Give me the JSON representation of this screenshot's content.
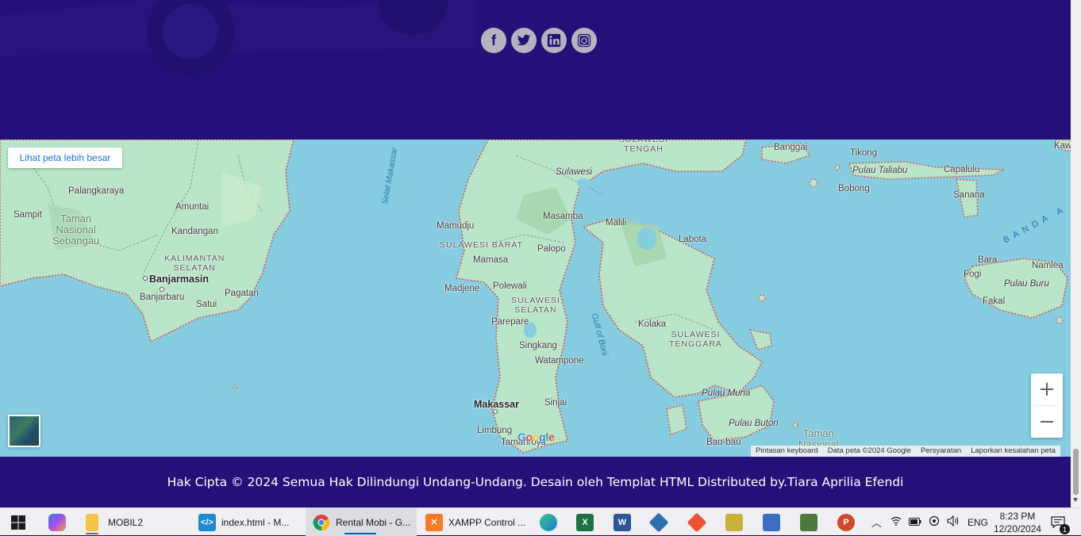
{
  "social": {
    "facebook": "f",
    "twitter": "t",
    "linkedin": "in",
    "instagram": "ig"
  },
  "map": {
    "larger_map_label": "Lihat peta lebih besar",
    "zoom_in": "+",
    "zoom_out": "−",
    "attribution": [
      "Pintasan keyboard",
      "Data peta ©2024 Google",
      "Persyaratan",
      "Laporkan kesalahan peta"
    ],
    "google_logo": [
      "G",
      "o",
      "o",
      "g",
      "l",
      "e"
    ],
    "logo_colors": [
      "#4285f4",
      "#ea4335",
      "#fbbc05",
      "#4285f4",
      "#34a853",
      "#ea4335"
    ],
    "labels": {
      "palangkaraya": "Palangkaraya",
      "sampit": "Sampit",
      "taman_nasional_sebangau": "Taman\nNasional\nSebangau",
      "amuntai": "Amuntai",
      "kandangan": "Kandangan",
      "kalimantan_selatan": "KALIMANTAN\nSELATAN",
      "banjarmasin": "Banjarmasin",
      "banjarbaru": "Banjarbaru",
      "satui": "Satui",
      "pagatan": "Pagatan",
      "selat_makassar": "Selat Makassar",
      "sulawesi_tengah": "SULAWESI\nTENGAH",
      "sulawesi": "Sulawesi",
      "mamudju": "Mamudju",
      "masamba": "Masamba",
      "malili": "Malili",
      "sulawesi_barat": "SULAWESI BARAT",
      "mamasa": "Mamasa",
      "palopo": "Palopo",
      "labota": "Labota",
      "majene": "Madjene",
      "polewali": "Polewali",
      "sulawesi_selatan": "SULAWESI\nSELATAN",
      "parepare": "Parepare",
      "gulf_of_boni": "Gulf of Boni",
      "kolaka": "Kolaka",
      "sulawesi_tenggara": "SULAWESI\nTENGGARA",
      "singkang": "Singkang",
      "watampone": "Watampone",
      "makassar": "Makassar",
      "sinjai": "Sinjai",
      "pulau_muna": "Pulau Muna",
      "pulau_buton": "Pulau Buton",
      "limbung": "Limbung",
      "tamanroya": "Tamanroya",
      "bau_bau": "Bau-bau",
      "taman_nasional": "Taman\nNasional",
      "banggai": "Banggai",
      "tikong": "Tikong",
      "pulau_taliabu": "Pulau Taliabu",
      "capalulu": "Capalulu",
      "bobong": "Bobong",
      "sanana": "Sanana",
      "banda_sea": "BANDA A",
      "bara": "Bara",
      "namlea": "Namlea",
      "fogi": "Fogi",
      "pulau_buru": "Pulau Buru",
      "fakal": "Fakal",
      "kaw": "Kaw"
    }
  },
  "footer": {
    "copyright": "Hak Cipta © 2024 Semua Hak Dilindungi Undang-Undang. Desain oleh Templat HTML Distributed by.Tiara Aprilia Efendi"
  },
  "taskbar": {
    "apps": [
      {
        "name": "start",
        "label": ""
      },
      {
        "name": "copilot",
        "label": ""
      },
      {
        "name": "explorer",
        "label": "MOBIL2"
      },
      {
        "name": "vscode",
        "label": "index.html - M..."
      },
      {
        "name": "chrome",
        "label": "Rental Mobi - G..."
      },
      {
        "name": "xampp",
        "label": "XAMPP Control ..."
      }
    ],
    "language": "ENG",
    "time": "8:23 PM",
    "date": "12/20/2024",
    "notification_count": "1"
  },
  "colors": {
    "footer_bg": "#25107a",
    "water": "#86cde2",
    "land": "#bfe6cc",
    "border_red": "#d9534f"
  }
}
